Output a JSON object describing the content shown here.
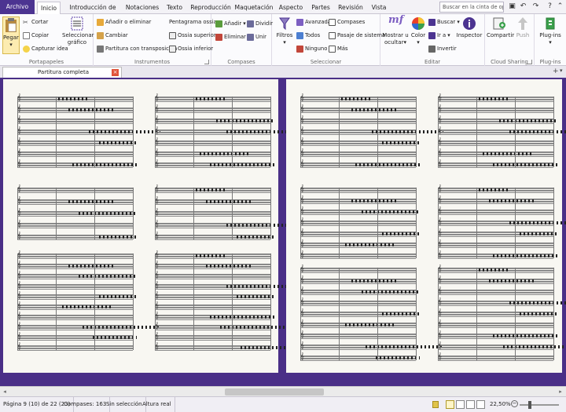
{
  "menu": {
    "tabs": [
      "Archivo",
      "Inicio",
      "Introducción de notas",
      "Notaciones",
      "Texto",
      "Reproducción",
      "Maquetación",
      "Aspecto",
      "Partes",
      "Revisión",
      "Vista"
    ],
    "active": "Inicio",
    "search_placeholder": "Buscar en la cinta de opci..."
  },
  "ribbon": {
    "portapapeles": {
      "label": "Portapapeles",
      "pegar": "Pegar",
      "cortar": "Cortar",
      "copiar": "Copiar",
      "capturar": "Capturar idea",
      "seleccionar_grafico": "Seleccionar gráfico"
    },
    "instrumentos": {
      "label": "Instrumentos",
      "anadir_eliminar": "Añadir o eliminar",
      "cambiar": "Cambiar",
      "partitura_transposicion": "Partitura con transposición",
      "pentagrama_ossia": "Pentagrama ossia",
      "ossia_superior": "Ossia superior",
      "ossia_inferior": "Ossia inferior"
    },
    "compases": {
      "label": "Compases",
      "anadir": "Añadir",
      "eliminar": "Eliminar",
      "dividir": "Dividir",
      "unir": "Unir"
    },
    "seleccionar": {
      "label": "Seleccionar",
      "filtros": "Filtros",
      "avanzada": "Avanzada",
      "todos": "Todos",
      "ninguno": "Ninguno",
      "compases": "Compases",
      "pasaje": "Pasaje de sistema",
      "mas": "Más"
    },
    "editar": {
      "label": "Editar",
      "mostrar_ocultar": "Mostrar u ocultar",
      "color": "Color",
      "buscar": "Buscar",
      "ir_a": "Ir a",
      "invertir": "Invertir",
      "inspector": "Inspector"
    },
    "cloud": {
      "label": "Cloud Sharing",
      "compartir": "Compartir",
      "push": "Push"
    },
    "plugins": {
      "label": "Plug-ins",
      "button": "Plug-ins"
    }
  },
  "document": {
    "tab_title": "Partitura completa"
  },
  "status": {
    "pagina": "Página 9 (10) de 22 (23)",
    "compases": "Compases: 163",
    "seleccion": "Sin selección",
    "altura": "Altura real",
    "zoom": "22,50%"
  },
  "colors": {
    "accent": "#4c3491",
    "score_background": "#4a2f87",
    "paper": "#f8f7f2"
  }
}
